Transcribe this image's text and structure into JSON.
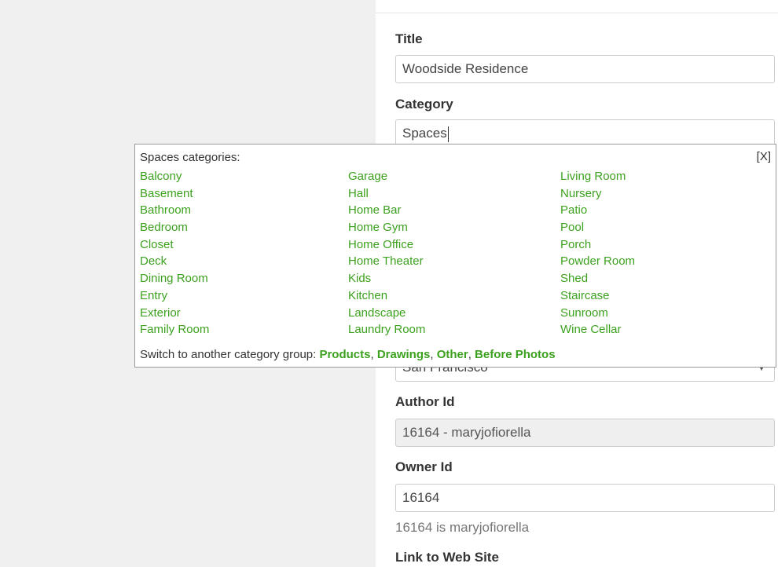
{
  "form": {
    "title_label": "Title",
    "title_value": "Woodside Residence",
    "category_label": "Category",
    "category_value": "Spaces",
    "city_value": "San Francisco",
    "author_label": "Author Id",
    "author_value": "16164 - maryjofiorella",
    "owner_label": "Owner Id",
    "owner_value": "16164",
    "owner_helper": "16164 is maryjofiorella",
    "website_label": "Link to Web Site"
  },
  "popup": {
    "heading": "Spaces categories:",
    "close_label": "[X]",
    "columns": [
      [
        "Balcony",
        "Basement",
        "Bathroom",
        "Bedroom",
        "Closet",
        "Deck",
        "Dining Room",
        "Entry",
        "Exterior",
        "Family Room"
      ],
      [
        "Garage",
        "Hall",
        "Home Bar",
        "Home Gym",
        "Home Office",
        "Home Theater",
        "Kids",
        "Kitchen",
        "Landscape",
        "Laundry Room"
      ],
      [
        "Living Room",
        "Nursery",
        "Patio",
        "Pool",
        "Porch",
        "Powder Room",
        "Shed",
        "Staircase",
        "Sunroom",
        "Wine Cellar"
      ]
    ],
    "switch_prefix": "Switch to another category group: ",
    "groups": [
      "Products",
      "Drawings",
      "Other",
      "Before Photos"
    ]
  },
  "colors": {
    "link_green": "#3ca11e",
    "page_bg": "#f0f0f0"
  }
}
